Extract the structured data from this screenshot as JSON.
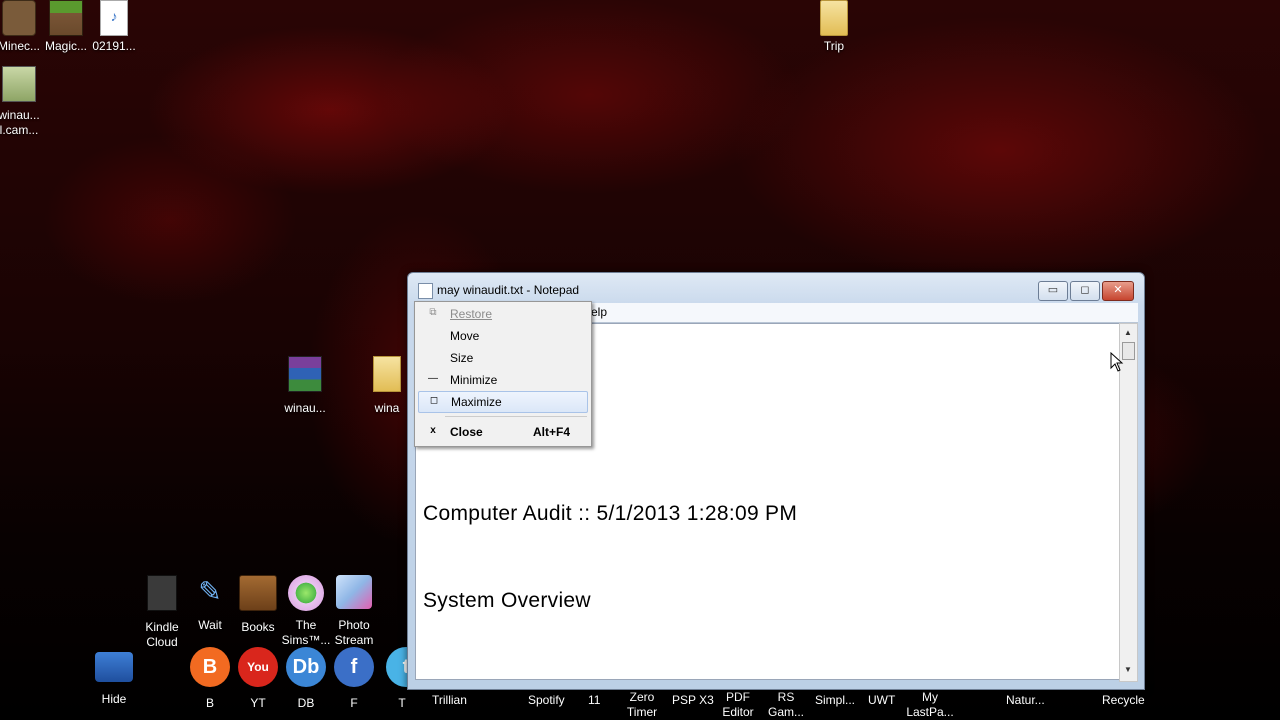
{
  "desktop": {
    "top_icons": [
      {
        "label": "Minec...",
        "icon": "minecraft-icon"
      },
      {
        "label": "Magic...",
        "icon": "minecraft-block-icon"
      },
      {
        "label": "02191...",
        "icon": "mp3-file-icon"
      },
      {
        "label": "Trip",
        "icon": "folder-icon"
      }
    ],
    "winaudit_cam": {
      "label_line1": "winau...",
      "label_line2": "l.cam...",
      "icon": "video-file-icon"
    },
    "middle_icons": [
      {
        "label": "winau...",
        "icon": "winrar-archive-icon"
      },
      {
        "label": "wina",
        "icon": "folder-icon"
      }
    ],
    "row2_icons": [
      {
        "label_line1": "Kindle",
        "label_line2": "Cloud",
        "icon": "kindle-icon"
      },
      {
        "label_line1": "Wait",
        "label_line2": "",
        "icon": "pencil-icon"
      },
      {
        "label_line1": "Books",
        "label_line2": "",
        "icon": "book-icon"
      },
      {
        "label_line1": "The",
        "label_line2": "Sims™...",
        "icon": "sims-icon"
      },
      {
        "label_line1": "Photo",
        "label_line2": "Stream",
        "icon": "photo-stream-icon"
      }
    ],
    "bottom_icons": [
      {
        "label_line1": "Hide",
        "label_line2": "",
        "icon": "lock-folder-icon"
      },
      {
        "label_line1": "B",
        "label_line2": "",
        "icon": "blogger-icon",
        "glyph": "B",
        "color": "#f26a21"
      },
      {
        "label_line1": "YT",
        "label_line2": "",
        "icon": "youtube-icon",
        "glyph": "You",
        "color": "#d9261c"
      },
      {
        "label_line1": "DB",
        "label_line2": "",
        "icon": "db-icon",
        "glyph": "Db",
        "color": "#3b86d6"
      },
      {
        "label_line1": "F",
        "label_line2": "",
        "icon": "facebook-icon",
        "glyph": "f",
        "color": "#3b6fc7"
      },
      {
        "label_line1": "T",
        "label_line2": "",
        "icon": "twitter-icon",
        "glyph": "t",
        "color": "#49b3e6"
      },
      {
        "label_line1": "Trillian",
        "label_line2": "",
        "icon": "trillian-icon"
      },
      {
        "label_line1": "Spotify",
        "label_line2": "",
        "icon": "spotify-icon"
      },
      {
        "label_line1": "11",
        "label_line2": "",
        "icon": "app-icon"
      },
      {
        "label_line1": "Zero",
        "label_line2": "Timer",
        "icon": "timer-icon"
      },
      {
        "label_line1": "PSP X3",
        "label_line2": "",
        "icon": "psp-icon"
      },
      {
        "label_line1": "PDF",
        "label_line2": "Editor",
        "icon": "pdf-icon"
      },
      {
        "label_line1": "RS",
        "label_line2": "Gam...",
        "icon": "game-icon"
      },
      {
        "label_line1": "Simpl...",
        "label_line2": "",
        "icon": "app-icon"
      },
      {
        "label_line1": "UWT",
        "label_line2": "",
        "icon": "app-icon"
      },
      {
        "label_line1": "My",
        "label_line2": "LastPa...",
        "icon": "lastpass-icon"
      },
      {
        "label_line1": "Natur...",
        "label_line2": "",
        "icon": "app-icon"
      },
      {
        "label_line1": "Recycle",
        "label_line2": "",
        "icon": "recycle-bin-icon"
      }
    ]
  },
  "notepad": {
    "title": "may winaudit.txt - Notepad",
    "menubar_partial": "elp",
    "lines": [
      "Computer  Audit  ::  5/1/2013  1:28:09  PM",
      "System  Overview"
    ],
    "buttons": {
      "minimize": "▭",
      "maximize": "◻",
      "close": "✕"
    }
  },
  "system_menu": {
    "items": [
      {
        "label": "Restore",
        "glyph": "⧉",
        "disabled": true
      },
      {
        "label": "Move",
        "glyph": "",
        "disabled": false
      },
      {
        "label": "Size",
        "glyph": "",
        "disabled": false
      },
      {
        "label": "Minimize",
        "glyph": "—",
        "disabled": false
      },
      {
        "label": "Maximize",
        "glyph": "◻",
        "disabled": false,
        "hover": true
      },
      {
        "label": "Close",
        "glyph": "x",
        "shortcut": "Alt+F4",
        "disabled": false,
        "bold": true
      }
    ]
  }
}
